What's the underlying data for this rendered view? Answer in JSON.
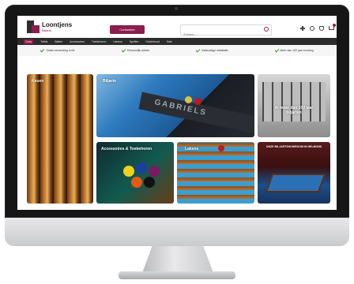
{
  "header": {
    "logo_name": "Loontjens",
    "logo_sub": "Biljarts",
    "cta_label": "Contacteer",
    "search_placeholder": "Zoeken..."
  },
  "nav": {
    "items": [
      "Cues",
      "Tafels",
      "Ballen",
      "Accessoires",
      "Toebehoren",
      "Lakens",
      "Spellen",
      "Onderhoud",
      "Sale"
    ]
  },
  "usps": {
    "items": [
      "Gratis verzending in NL",
      "Persoonlijk advies",
      "Vakkundige installatie",
      "Meer dan 100 jaar ervaring"
    ]
  },
  "tiles": {
    "cues": "Keuen",
    "biljarts": "Biljarts",
    "biljarts_brand": "GABRIELS",
    "history": "Al meer dan 100 jaar biljarten",
    "accessoires": "Accessoires & Toebehoren",
    "lakens": "Lakens",
    "showroom": "ONZE BILJARTSHOWROOM IN HELMOND"
  },
  "colors": {
    "brand": "#8b1d4f",
    "nav_bg": "#2c2c2c"
  }
}
